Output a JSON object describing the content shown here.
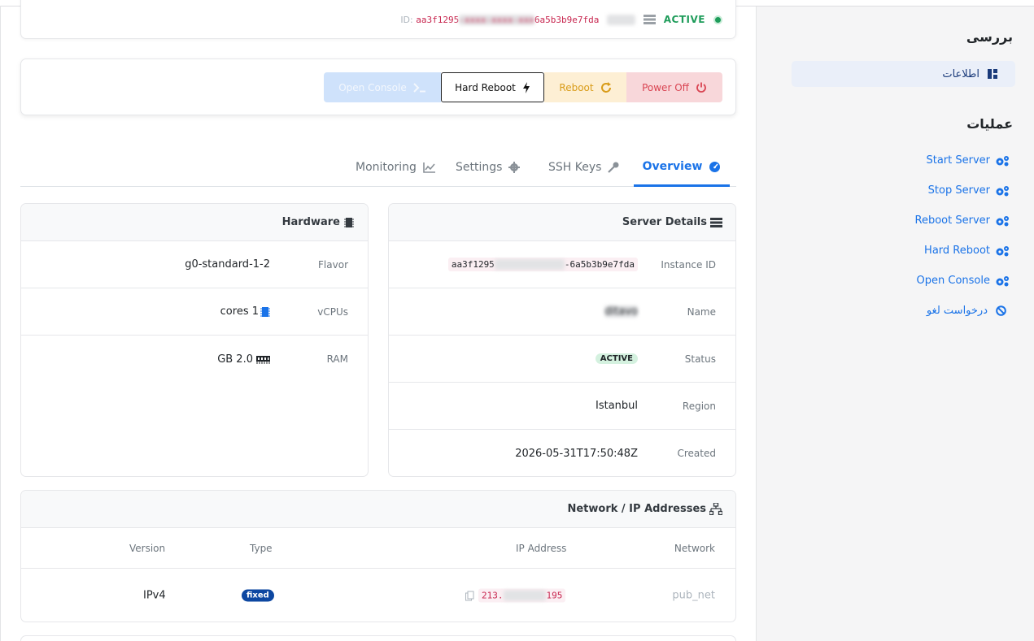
{
  "header": {
    "id_label": "ID:",
    "id_prefix": "aa3f1295",
    "id_suffix": "6a5b3b9e7fda",
    "server_name_hidden": "ditavo",
    "status": "ACTIVE"
  },
  "actions": {
    "open_console": "Open Console",
    "hard_reboot": "Hard Reboot",
    "reboot": "Reboot",
    "power_off": "Power Off"
  },
  "tabs": {
    "monitoring": "Monitoring",
    "settings": "Settings",
    "ssh_keys": "SSH Keys",
    "overview": "Overview"
  },
  "hardware": {
    "title": "Hardware",
    "rows": {
      "flavor_label": "Flavor",
      "flavor_value": "g0-standard-1-2",
      "vcpus_label": "vCPUs",
      "vcpus_value": "cores 1",
      "ram_label": "RAM",
      "ram_value": "GB 2.0"
    }
  },
  "server_details": {
    "title": "Server Details",
    "instance_id_label": "Instance ID",
    "instance_id_prefix": "aa3f1295",
    "instance_id_suffix": "-6a5b3b9e7fda",
    "name_label": "Name",
    "status_label": "Status",
    "status_value": "ACTIVE",
    "region_label": "Region",
    "region_value": "Istanbul",
    "created_label": "Created",
    "created_value": "2026-05-31T17:50:48Z"
  },
  "network": {
    "title": "Network / IP Addresses",
    "columns": {
      "version": "Version",
      "type": "Type",
      "ip": "IP Address",
      "network": "Network"
    },
    "rows": [
      {
        "version": "IPv4",
        "type": "fixed",
        "ip_prefix": "213.",
        "ip_suffix": "195",
        "network": "pub_net"
      }
    ]
  },
  "sidebar": {
    "review_title": "بررسی",
    "info_item": "اطلاعات",
    "operations_title": "عملیات",
    "items": [
      "Start Server",
      "Stop Server",
      "Reboot Server",
      "Hard Reboot",
      "Open Console",
      "درخواست لغو"
    ]
  },
  "colors": {
    "accent": "#1a73e8",
    "active_green": "#1e9c5a",
    "danger": "#d94452",
    "warning": "#d99c19"
  }
}
